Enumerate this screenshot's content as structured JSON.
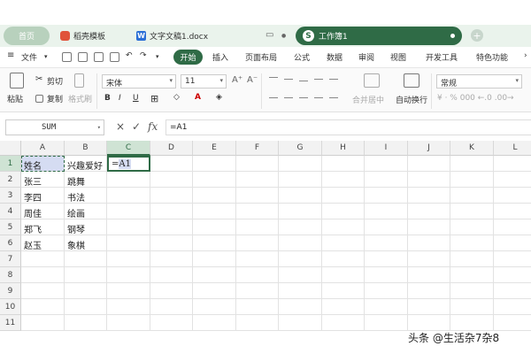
{
  "tabs": {
    "home": "首页",
    "template": "稻壳模板",
    "doc": "文字文稿1.docx",
    "book": "工作簿1"
  },
  "menu": {
    "file": "文件",
    "items": [
      "开始",
      "插入",
      "页面布局",
      "公式",
      "数据",
      "审阅",
      "视图",
      "开发工具",
      "特色功能"
    ]
  },
  "ribbon": {
    "paste": "粘贴",
    "cut": "剪切",
    "copy": "复制",
    "format_painter": "格式刷",
    "font_name": "宋体",
    "font_size": "11",
    "merge_center": "合并居中",
    "wrap_text": "自动换行",
    "number_format": "常规",
    "number_symbols": "¥ · % 000 ←.0 .00→"
  },
  "formula_bar": {
    "name_box": "SUM",
    "cancel": "×",
    "confirm": "✓",
    "fx": "fx",
    "formula": "=A1"
  },
  "grid": {
    "columns": [
      "A",
      "B",
      "C",
      "D",
      "E",
      "F",
      "G",
      "H",
      "I",
      "J",
      "K",
      "L"
    ],
    "rows": [
      "1",
      "2",
      "3",
      "4",
      "5",
      "6",
      "7",
      "8",
      "9",
      "10",
      "11"
    ],
    "cells": [
      [
        "姓名",
        "兴趣爱好",
        "=A1"
      ],
      [
        "张三",
        "跳舞",
        ""
      ],
      [
        "李四",
        "书法",
        ""
      ],
      [
        "周佳",
        "绘画",
        ""
      ],
      [
        "郑飞",
        "钢琴",
        ""
      ],
      [
        "赵玉",
        "象棋",
        ""
      ]
    ]
  },
  "watermark": "头条 @生活杂7杂8",
  "colors": {
    "accent": "#2f6b46",
    "selection": "#d5dcf2"
  }
}
